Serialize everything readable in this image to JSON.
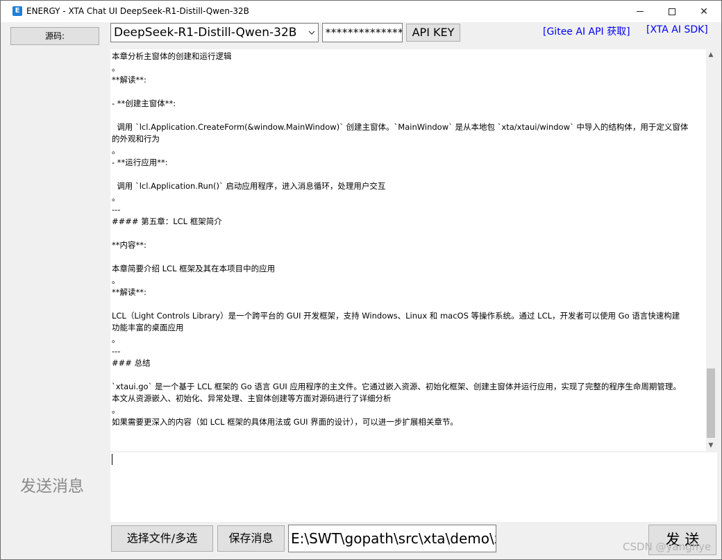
{
  "window": {
    "title": "ENERGY - XTA Chat UI DeepSeek-R1-Distill-Qwen-32B",
    "app_icon": "energy-app-icon",
    "controls": {
      "minimize": "minimize-icon",
      "maximize": "maximize-icon",
      "close": "✕"
    }
  },
  "left_panel": {
    "source_button": "源码:",
    "send_label": "发送消息"
  },
  "toolbar": {
    "model_select": {
      "value": "DeepSeek-R1-Distill-Qwen-32B"
    },
    "api_key_input": {
      "value": "******************"
    },
    "api_key_button": "API KEY",
    "links": [
      "[Gitee AI API 获取]",
      "[XTA AI SDK]"
    ]
  },
  "chat": {
    "lines": [
      "本章分析主窗体的创建和运行逻辑",
      "。",
      "**解读**:",
      "",
      "- **创建主窗体**:",
      "",
      "  调用 `lcl.Application.CreateForm(&window.MainWindow)` 创建主窗体。`MainWindow` 是从本地包 `xta/xtaui/window` 中导入的结构体，用于定义窗体",
      "的外观和行为",
      "。",
      "- **运行应用**:",
      "",
      "  调用 `lcl.Application.Run()` 启动应用程序，进入消息循环，处理用户交互",
      "。",
      "---",
      "#### 第五章：LCL 框架简介",
      "",
      "**内容**:",
      "",
      "本章简要介绍 LCL 框架及其在本项目中的应用",
      "。",
      "**解读**:",
      "",
      "LCL（Light Controls Library）是一个跨平台的 GUI 开发框架，支持 Windows、Linux 和 macOS 等操作系统。通过 LCL，开发者可以使用 Go 语言快速构建",
      "功能丰富的桌面应用",
      "。",
      "---",
      "### 总结",
      "",
      "`xtaui.go` 是一个基于 LCL 框架的 Go 语言 GUI 应用程序的主文件。它通过嵌入资源、初始化框架、创建主窗体并运行应用，实现了完整的程序生命周期管理。",
      "本文从资源嵌入、初始化、异常处理、主窗体创建等方面对源码进行了详细分析",
      "。",
      "如果需要更深入的内容（如 LCL 框架的具体用法或 GUI 界面的设计），可以进一步扩展相关章节。"
    ]
  },
  "bottom": {
    "file_button": "选择文件/多选",
    "save_button": "保存消息",
    "path_input": {
      "value": "E:\\SWT\\gopath\\src\\xta\\demo\\xta"
    },
    "send_button": "发 送"
  },
  "watermark": "CSDN @yanghye"
}
